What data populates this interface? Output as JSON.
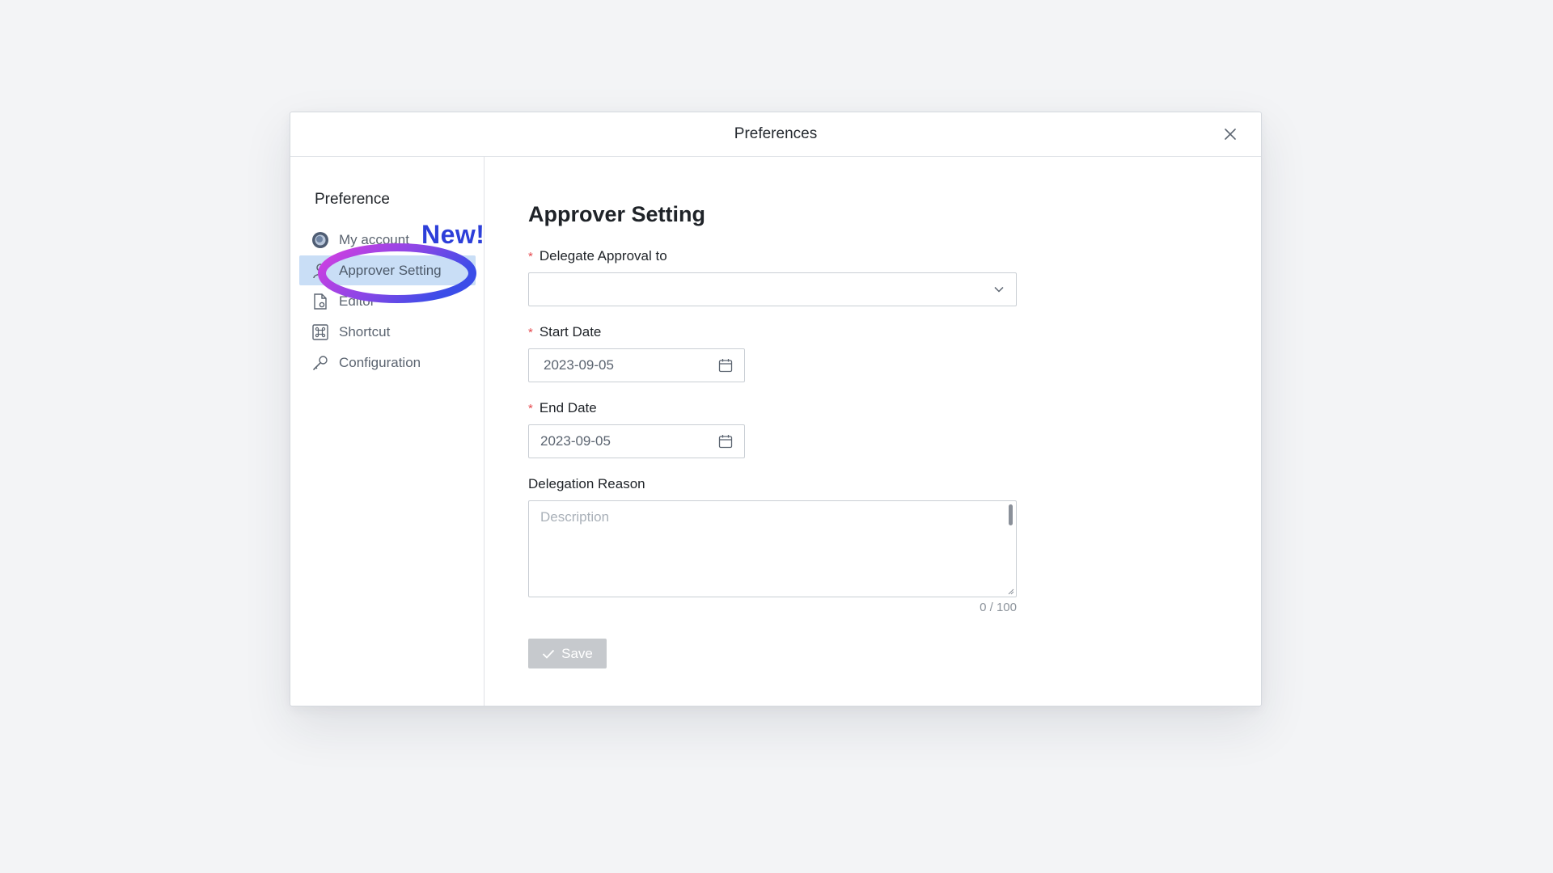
{
  "modal": {
    "title": "Preferences",
    "close_icon": "close-icon"
  },
  "sidebar": {
    "title": "Preference",
    "new_badge": "New!",
    "items": [
      {
        "label": "My account",
        "icon": "avatar-icon",
        "active": false
      },
      {
        "label": "Approver Setting",
        "icon": "user-icon",
        "active": true
      },
      {
        "label": "Editor",
        "icon": "file-settings-icon",
        "active": false
      },
      {
        "label": "Shortcut",
        "icon": "command-key-icon",
        "active": false
      },
      {
        "label": "Configuration",
        "icon": "wrench-icon",
        "active": false
      }
    ]
  },
  "form": {
    "title": "Approver Setting",
    "delegate": {
      "label": "Delegate Approval to",
      "value": "",
      "icon": "chevron-down-icon"
    },
    "start_date": {
      "label": "Start Date",
      "value": "2023-09-05",
      "icon": "calendar-icon"
    },
    "end_date": {
      "label": "End Date",
      "value": "2023-09-05",
      "icon": "calendar-icon"
    },
    "reason": {
      "label": "Delegation Reason",
      "placeholder": "Description",
      "counter": "0 / 100"
    },
    "save_label": "Save"
  },
  "colors": {
    "accent_highlight": "#c9def6",
    "required": "#e5484d",
    "new_badge": "#2d3fd9",
    "ring_start": "#d63ee0",
    "ring_end": "#3b4de8",
    "save_disabled": "#c6c9cd"
  }
}
